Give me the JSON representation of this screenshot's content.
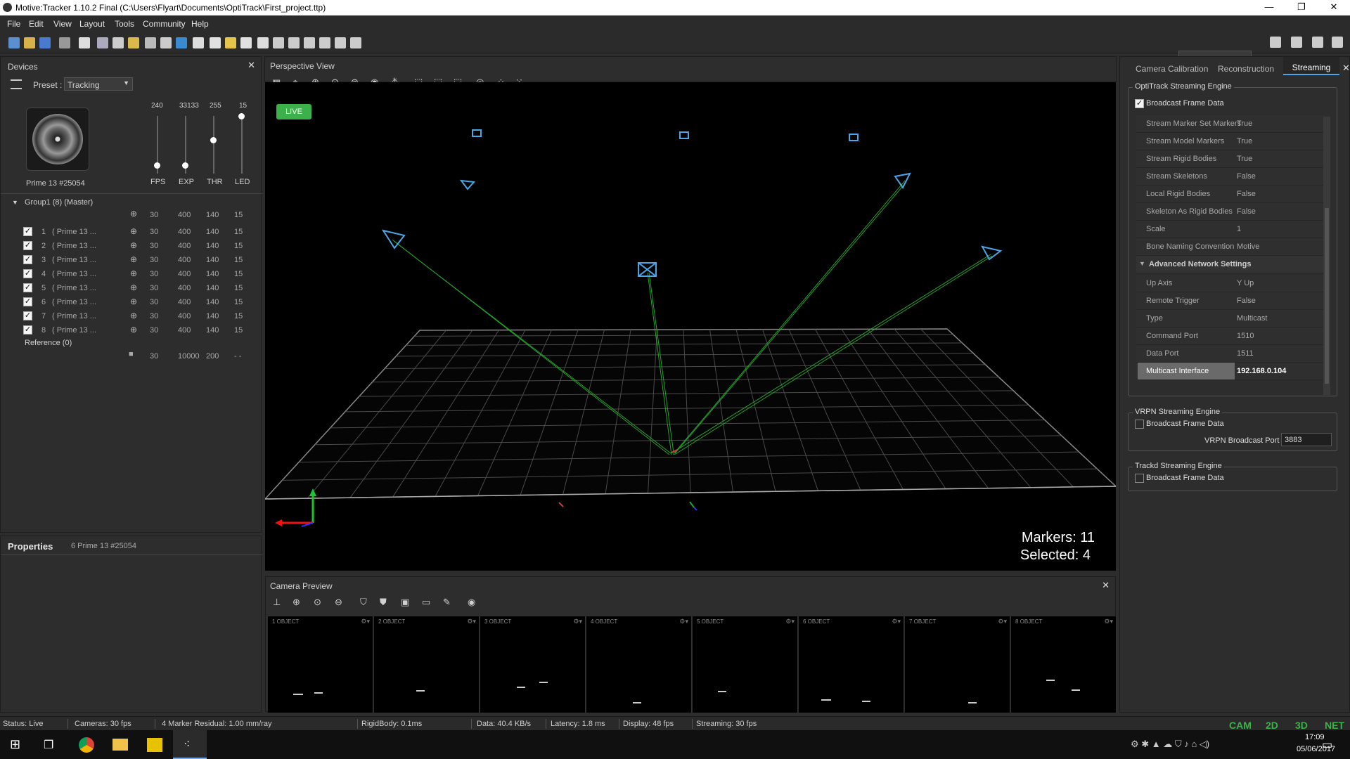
{
  "window": {
    "title": "Motive:Tracker 1.10.2 Final (C:\\Users\\Flyart\\Documents\\OptiTrack\\First_project.ttp)"
  },
  "menu": [
    "File",
    "Edit",
    "View",
    "Layout",
    "Tools",
    "Community",
    "Help"
  ],
  "devices": {
    "title": "Devices",
    "preset_label": "Preset :",
    "preset_value": "Tracking",
    "camera_name": "Prime 13 #25054",
    "sliders": [
      {
        "label": "FPS",
        "value": "240",
        "level": 0.0
      },
      {
        "label": "EXP",
        "value": "33133",
        "level": 0.0
      },
      {
        "label": "THR",
        "value": "255",
        "level": 0.5
      },
      {
        "label": "LED",
        "value": "15",
        "level": 1.0
      }
    ],
    "group_title": "Group1 (8) (Master)",
    "cameras": [
      {
        "num": "1",
        "name": "( Prime 13 ...",
        "fps": "30",
        "exp": "400",
        "thr": "140",
        "led": "15"
      },
      {
        "num": "2",
        "name": "( Prime 13 ...",
        "fps": "30",
        "exp": "400",
        "thr": "140",
        "led": "15"
      },
      {
        "num": "3",
        "name": "( Prime 13 ...",
        "fps": "30",
        "exp": "400",
        "thr": "140",
        "led": "15"
      },
      {
        "num": "4",
        "name": "( Prime 13 ...",
        "fps": "30",
        "exp": "400",
        "thr": "140",
        "led": "15"
      },
      {
        "num": "5",
        "name": "( Prime 13 ...",
        "fps": "30",
        "exp": "400",
        "thr": "140",
        "led": "15"
      },
      {
        "num": "6",
        "name": "( Prime 13 ...",
        "fps": "30",
        "exp": "400",
        "thr": "140",
        "led": "15"
      },
      {
        "num": "7",
        "name": "( Prime 13 ...",
        "fps": "30",
        "exp": "400",
        "thr": "140",
        "led": "15"
      },
      {
        "num": "8",
        "name": "( Prime 13 ...",
        "fps": "30",
        "exp": "400",
        "thr": "140",
        "led": "15"
      }
    ],
    "reference_title": "Reference (0)",
    "reference": {
      "fps": "30",
      "exp": "10000",
      "thr": "200",
      "led": "- -"
    }
  },
  "properties": {
    "title": "Properties",
    "subtitle": "6 Prime 13 #25054"
  },
  "perspective": {
    "title": "Perspective View",
    "live": "LIVE",
    "markers": "Markers: 11",
    "selected": "Selected: 4"
  },
  "preview": {
    "title": "Camera Preview",
    "cells": [
      {
        "label": "1  OBJECT"
      },
      {
        "label": "2  OBJECT"
      },
      {
        "label": "3  OBJECT"
      },
      {
        "label": "4  OBJECT"
      },
      {
        "label": "5  OBJECT"
      },
      {
        "label": "6  OBJECT"
      },
      {
        "label": "7  OBJECT"
      },
      {
        "label": "8  OBJECT"
      }
    ]
  },
  "right": {
    "tabs": [
      "Camera Calibration",
      "Reconstruction",
      "Streaming"
    ],
    "opti_title": "OptiTrack Streaming Engine",
    "broadcast": "Broadcast Frame Data",
    "props": [
      {
        "k": "Stream Marker Set Markers",
        "v": "True"
      },
      {
        "k": "Stream Model Markers",
        "v": "True"
      },
      {
        "k": "Stream Rigid Bodies",
        "v": "True"
      },
      {
        "k": "Stream Skeletons",
        "v": "False"
      },
      {
        "k": "Local Rigid Bodies",
        "v": "False"
      },
      {
        "k": "Skeleton As Rigid Bodies",
        "v": "False"
      },
      {
        "k": "Scale",
        "v": "1"
      },
      {
        "k": "Bone Naming Convention",
        "v": "Motive"
      }
    ],
    "adv_title": "Advanced Network Settings",
    "adv": [
      {
        "k": "Up Axis",
        "v": "Y Up"
      },
      {
        "k": "Remote Trigger",
        "v": "False"
      },
      {
        "k": "Type",
        "v": "Multicast"
      },
      {
        "k": "Command Port",
        "v": "1510"
      },
      {
        "k": "Data Port",
        "v": "1511"
      },
      {
        "k": "Multicast Interface",
        "v": "192.168.0.104"
      }
    ],
    "vrpn_title": "VRPN Streaming Engine",
    "vrpn_broadcast": "Broadcast Frame Data",
    "vrpn_port_label": "VRPN Broadcast Port",
    "vrpn_port": "3883",
    "trackd_title": "Trackd Streaming Engine",
    "trackd_broadcast": "Broadcast Frame Data"
  },
  "status": [
    "Status: Live",
    "Cameras: 30 fps",
    "4 Marker Residual: 1.00 mm/ray",
    "RigidBody: 0.1ms",
    "Data: 40.4 KB/s",
    "Latency: 1.8 ms",
    "Display: 48 fps",
    "Streaming: 30 fps"
  ],
  "modes": [
    "CAM",
    "2D",
    "3D",
    "NET"
  ],
  "taskbar": {
    "time": "17:09",
    "date": "05/06/2017"
  }
}
